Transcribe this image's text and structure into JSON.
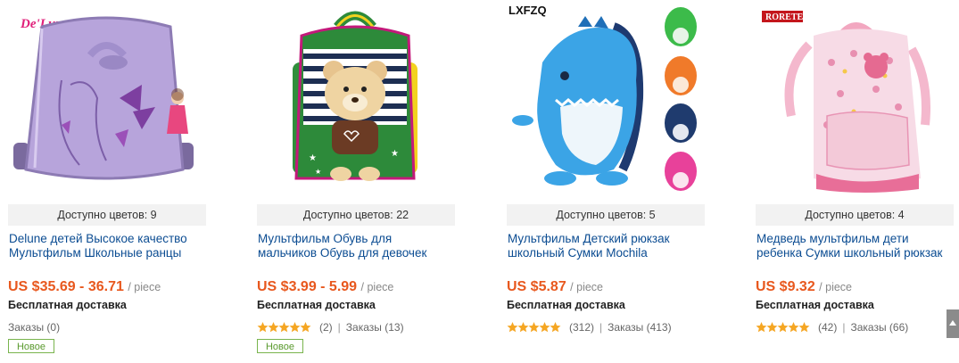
{
  "products": [
    {
      "brand_logo": "De'Lune",
      "colors_text": "Доступно цветов: 9",
      "title_line1": "Delune детей Высокое качество",
      "title_line2": "Мультфильм Школьные ранцы",
      "price": "US $35.69 - 36.71",
      "price_unit": "/ piece",
      "shipping": "Бесплатная доставка",
      "orders": "Заказы (0)",
      "badge": "Новое",
      "image_icon": "purple-butterfly-backpack"
    },
    {
      "colors_text": "Доступно цветов: 22",
      "title_line1": "Мультфильм Обувь для",
      "title_line2": "мальчиков Обувь для девочек",
      "price": "US $3.99 - 5.99",
      "price_unit": "/ piece",
      "shipping": "Бесплатная доставка",
      "rating_count": "(2)",
      "separator": "|",
      "orders": "Заказы (13)",
      "badge": "Новое",
      "image_icon": "teddy-bear-backpack"
    },
    {
      "brand_logo": "LXFZQ",
      "colors_text": "Доступно цветов: 5",
      "title_line1": "Мультфильм Детский рюкзак",
      "title_line2": "школьный Сумки Mochila",
      "price": "US $5.87",
      "price_unit": "/ piece",
      "shipping": "Бесплатная доставка",
      "rating_count": "(312)",
      "separator": "|",
      "orders": "Заказы (413)",
      "image_icon": "dinosaur-backpack"
    },
    {
      "brand_logo": "RORETE",
      "colors_text": "Доступно цветов: 4",
      "title_line1": "Медведь мультфильм дети",
      "title_line2": "ребенка Сумки школьный рюкзак",
      "price": "US $9.32",
      "price_unit": "/ piece",
      "shipping": "Бесплатная доставка",
      "rating_count": "(42)",
      "separator": "|",
      "orders": "Заказы (66)",
      "image_icon": "pink-floral-backpack"
    }
  ],
  "theme": {
    "title_color": "#0b4c92",
    "price_color": "#e8581e",
    "star_color": "#f5a623",
    "badge_color": "#5a9a2e"
  }
}
